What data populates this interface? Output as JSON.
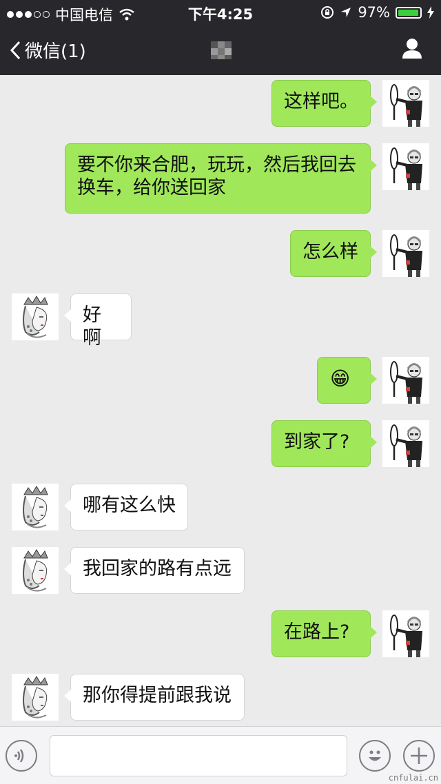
{
  "status_bar": {
    "carrier": "中国电信",
    "time": "下午4:25",
    "battery_percent": "97%",
    "battery_level": 0.97,
    "signal_dots_filled": 3,
    "signal_dots_total": 5
  },
  "nav": {
    "back_label": "微信(1)",
    "title_icon": "pixelated-name",
    "profile_icon": "person-icon"
  },
  "messages": [
    {
      "side": "out",
      "text": "这样吧。"
    },
    {
      "side": "out",
      "text": "要不你来合肥，玩玩，然后我回去换车，给你送回家"
    },
    {
      "side": "out",
      "text": "怎么样"
    },
    {
      "side": "in",
      "text": "好啊"
    },
    {
      "side": "out",
      "text": "😁",
      "emoji": true
    },
    {
      "side": "out",
      "text": "到家了?"
    },
    {
      "side": "in",
      "text": "哪有这么快"
    },
    {
      "side": "in",
      "text": "我回家的路有点远"
    },
    {
      "side": "out",
      "text": "在路上?"
    },
    {
      "side": "in",
      "text": "那你得提前跟我说"
    }
  ],
  "input_bar": {
    "voice_icon": "voice-icon",
    "emoji_icon": "smiley-icon",
    "plus_icon": "plus-icon",
    "input_value": ""
  },
  "watermark": "cnfulai.cn",
  "colors": {
    "outgoing_bubble": "#a0e75a",
    "incoming_bubble": "#ffffff",
    "bar_bg": "#28282c",
    "chat_bg": "#ebebeb"
  }
}
